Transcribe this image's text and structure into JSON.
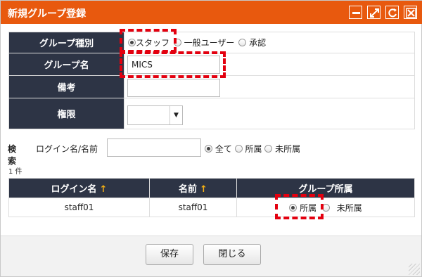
{
  "dialog": {
    "title": "新規グループ登録",
    "titlebar_icons": [
      "minimize-icon",
      "maximize-icon",
      "refresh-icon",
      "close-icon"
    ]
  },
  "form": {
    "group_type": {
      "label": "グループ種別",
      "options": [
        "スタッフ",
        "一般ユーザー",
        "承認"
      ],
      "selected": "スタッフ"
    },
    "group_name": {
      "label": "グループ名",
      "value": "MICS"
    },
    "remarks": {
      "label": "備考",
      "value": ""
    },
    "permission": {
      "label": "権限",
      "value": ""
    }
  },
  "search": {
    "label": "検索",
    "field_label": "ログイン名/名前",
    "value": "",
    "filter_options": [
      "全て",
      "所属",
      "未所属"
    ],
    "filter_selected": "全て"
  },
  "result_count": "1 件",
  "table": {
    "headers": [
      "ログイン名",
      "名前",
      "グループ所属"
    ],
    "sort_arrow": "↑",
    "rows": [
      {
        "login": "staff01",
        "name": "staff01",
        "membership_options": [
          "所属",
          "未所属"
        ],
        "membership_selected": "所属"
      }
    ]
  },
  "buttons": {
    "save": "保存",
    "close": "閉じる"
  },
  "colors": {
    "titlebar": "#e8590e",
    "header_bg": "#2d3445",
    "highlight": "#e3000f",
    "sort_arrow": "#f5b014"
  }
}
